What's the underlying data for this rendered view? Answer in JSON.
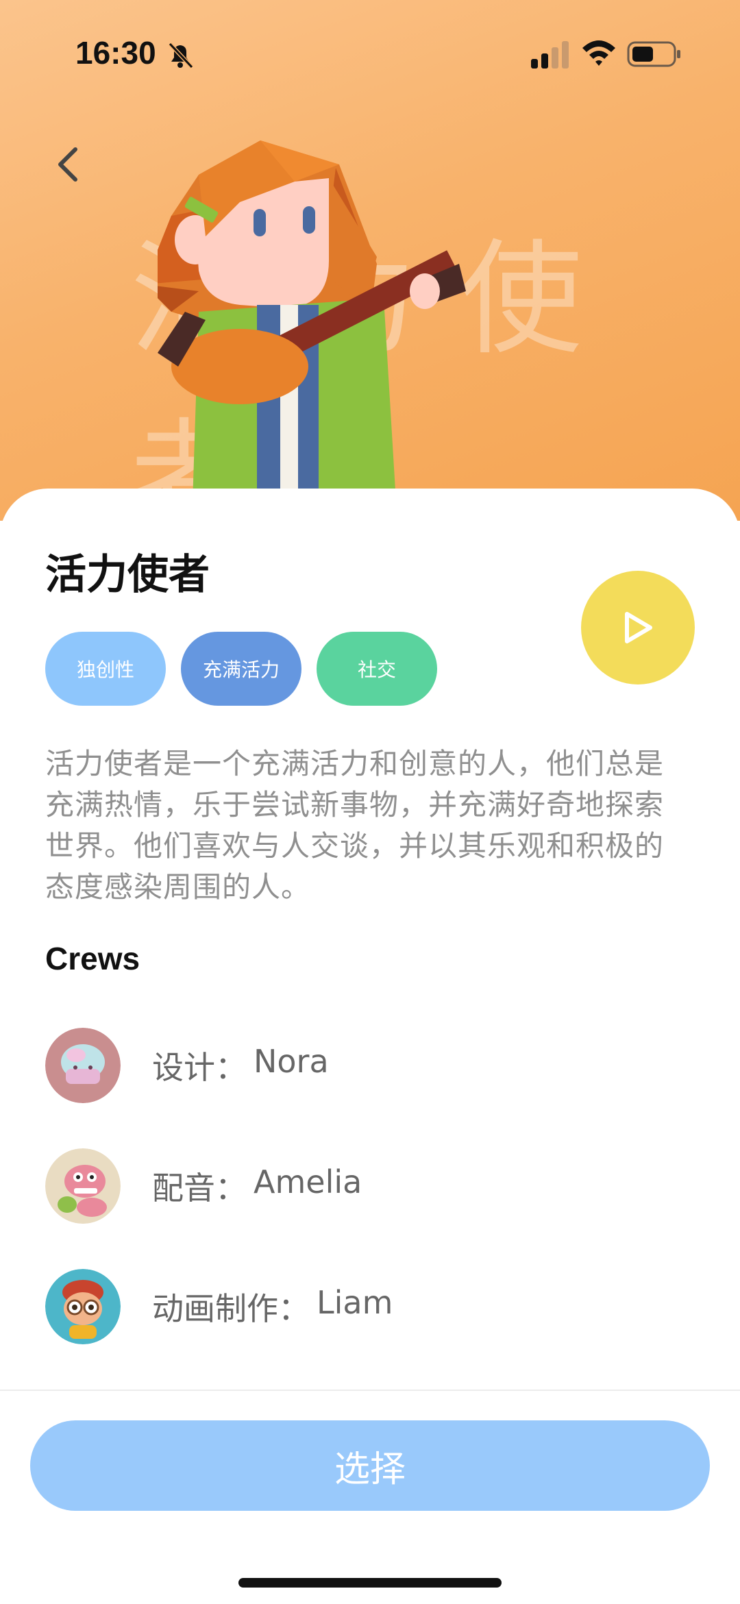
{
  "status": {
    "time": "16:30"
  },
  "hero": {
    "watermark": "活力使者"
  },
  "character": {
    "name": "活力使者"
  },
  "tags": [
    {
      "label": "独创性",
      "color": "#8ec6fc"
    },
    {
      "label": "充满活力",
      "color": "#6597e0"
    },
    {
      "label": "社交",
      "color": "#5ad39e"
    }
  ],
  "description": "活力使者是一个充满活力和创意的人，他们总是充满热情，乐于尝试新事物，并充满好奇地探索世界。他们喜欢与人交谈，并以其乐观和积极的态度感染周围的人。",
  "crews": {
    "title": "Crews",
    "members": [
      {
        "role": "设计：",
        "name": "Nora",
        "avatar": "jellyfish-avatar"
      },
      {
        "role": "配音：",
        "name": "Amelia",
        "avatar": "dinosaur-avatar"
      },
      {
        "role": "动画制作：",
        "name": "Liam",
        "avatar": "monkey-avatar"
      }
    ]
  },
  "actions": {
    "select_label": "选择"
  },
  "colors": {
    "accent_yellow": "#f3dc5a",
    "hero_orange": "#f8b26b",
    "button_blue": "#99c9fb"
  }
}
